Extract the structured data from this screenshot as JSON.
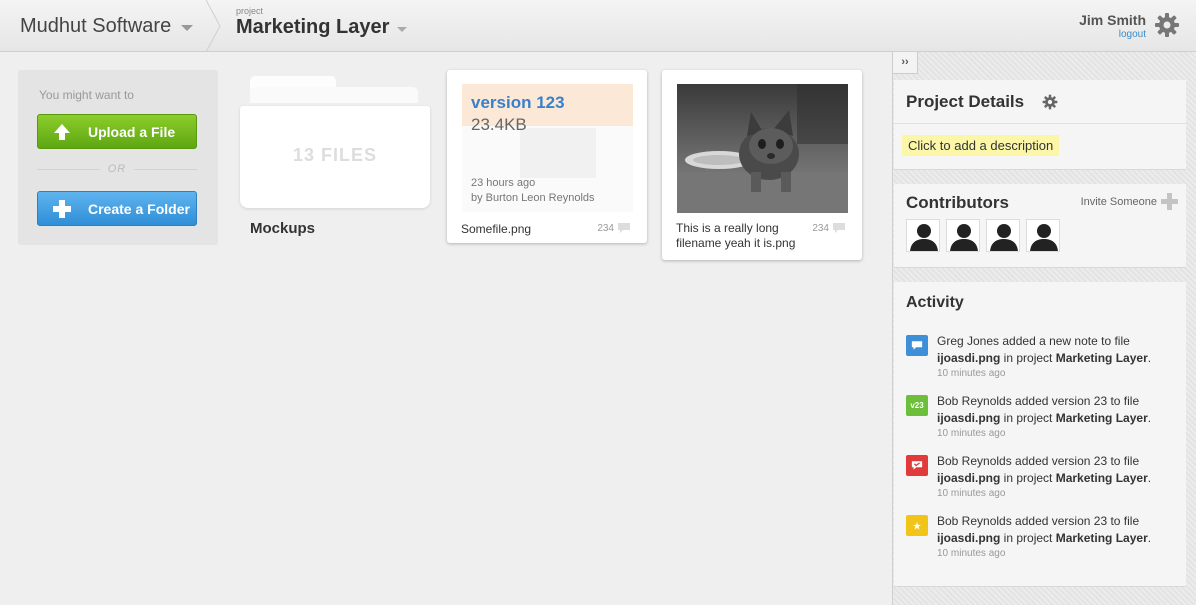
{
  "header": {
    "org_name": "Mudhut Software",
    "project_small_label": "project",
    "project_name": "Marketing Layer",
    "user_name": "Jim Smith",
    "logout_label": "logout"
  },
  "suggest": {
    "hint": "You might want to",
    "upload_label": "Upload a File",
    "or_label": "OR",
    "folder_label": "Create a Folder"
  },
  "folder": {
    "count_label": "13 FILES",
    "name": "Mockups"
  },
  "files": [
    {
      "version": "version 123",
      "size": "23.4KB",
      "when": "23 hours ago",
      "by": "by Burton Leon Reynolds",
      "name": "Somefile.png",
      "comments": "234"
    },
    {
      "name": "This is a really long filename yeah it is.png",
      "comments": "234"
    }
  ],
  "sidebar": {
    "collapse_label": "››",
    "details_title": "Project Details",
    "description_prompt": "Click to add a description",
    "contributors_title": "Contributors",
    "invite_label": "Invite Someone",
    "activity_title": "Activity",
    "activity": [
      {
        "icon": "comment-icon",
        "color": "#3d8fd8",
        "badge": "",
        "actor_text": "Greg Jones added a new note to file",
        "file": "ijoasdi.png",
        "mid": " in project ",
        "project": "Marketing Layer",
        "end": ".",
        "time": "10 minutes ago"
      },
      {
        "icon": "version-icon",
        "color": "#6cbf3a",
        "badge": "v23",
        "actor_text": "Bob Reynolds added version 23 to file",
        "file": "ijoasdi.png",
        "mid": " in project ",
        "project": "Marketing Layer",
        "end": ".",
        "time": "10 minutes ago"
      },
      {
        "icon": "approval-icon",
        "color": "#e03a3a",
        "badge": "",
        "actor_text": "Bob Reynolds added version 23 to file",
        "file": "ijoasdi.png",
        "mid": " in project ",
        "project": "Marketing Layer",
        "end": ".",
        "time": "10 minutes ago"
      },
      {
        "icon": "star-icon",
        "color": "#f0c419",
        "badge": "",
        "actor_text": "Bob Reynolds added version 23 to file",
        "file": "ijoasdi.png",
        "mid": " in project ",
        "project": "Marketing Layer",
        "end": ".",
        "time": "10 minutes ago"
      }
    ]
  }
}
